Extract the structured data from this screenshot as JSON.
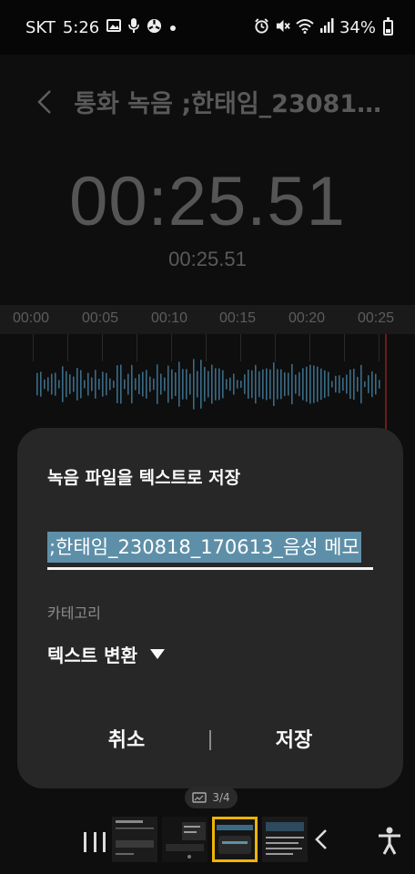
{
  "status_bar": {
    "carrier": "SKT",
    "time": "5:26",
    "battery": "34%",
    "battery_level": 0.34,
    "icons": [
      "gallery-icon",
      "mic-icon",
      "fan-icon",
      "dot-icon",
      "alarm-icon",
      "mute-icon",
      "wifi-icon",
      "signal-icon",
      "battery-icon"
    ]
  },
  "header": {
    "title": "통화 녹음 ;한태임_230818..."
  },
  "player": {
    "elapsed_main": "00:25.51",
    "elapsed_sub": "00:25.51",
    "ticks": [
      "00:00",
      "00:05",
      "00:10",
      "00:15",
      "00:20",
      "00:25"
    ]
  },
  "dialog": {
    "title": "녹음 파일을 텍스트로 저장",
    "filename_value": ";한태임_230818_170613_음성 메모",
    "category_label": "카테고리",
    "category_value": "텍스트 변환",
    "cancel_label": "취소",
    "save_label": "저장"
  },
  "nav": {
    "page_indicator": "3/4"
  },
  "colors": {
    "dialog_bg": "#272727",
    "selection": "#5e8fa8",
    "wave": "#3a6b86",
    "active_thumb": "#f0b400"
  }
}
